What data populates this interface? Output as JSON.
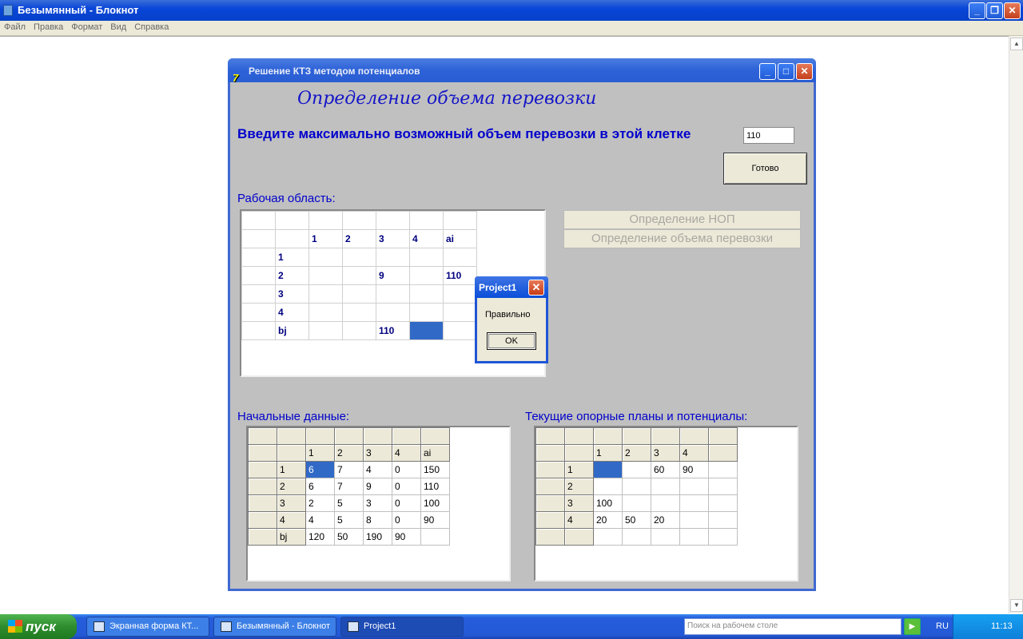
{
  "notepad": {
    "title": "Безымянный - Блокнот",
    "menu": [
      "Файл",
      "Правка",
      "Формат",
      "Вид",
      "Справка"
    ]
  },
  "app": {
    "title": "Решение КТЗ методом потенциалов",
    "header": "Определение объема перевозки",
    "prompt": "Введите максимально возможный объем перевозки в этой клетке",
    "input_value": "110",
    "ready_button": "Готово",
    "workarea_label": "Рабочая область:",
    "btn_nop": "Определение НОП",
    "btn_volume": "Определение объема перевозки",
    "initial_label": "Начальные данные:",
    "current_label": "Текущие опорные планы и потенциалы:",
    "work_grid": [
      [
        "",
        "",
        "",
        "",
        "",
        "",
        ""
      ],
      [
        "",
        "",
        "1",
        "2",
        "3",
        "4",
        "ai"
      ],
      [
        "",
        "1",
        "",
        "",
        "",
        "",
        ""
      ],
      [
        "",
        "2",
        "",
        "",
        "9",
        "",
        "110"
      ],
      [
        "",
        "3",
        "",
        "",
        "",
        "",
        ""
      ],
      [
        "",
        "4",
        "",
        "",
        "",
        "",
        ""
      ],
      [
        "",
        "bj",
        "",
        "",
        "110",
        "",
        ""
      ]
    ],
    "initial_grid": [
      [
        "",
        "",
        "",
        "",
        "",
        "",
        ""
      ],
      [
        "",
        "",
        "1",
        "2",
        "3",
        "4",
        "ai"
      ],
      [
        "",
        "1",
        "6",
        "7",
        "4",
        "0",
        "150"
      ],
      [
        "",
        "2",
        "6",
        "7",
        "9",
        "0",
        "110"
      ],
      [
        "",
        "3",
        "2",
        "5",
        "3",
        "0",
        "100"
      ],
      [
        "",
        "4",
        "4",
        "5",
        "8",
        "0",
        "90"
      ],
      [
        "",
        "bj",
        "120",
        "50",
        "190",
        "90",
        ""
      ]
    ],
    "current_grid": [
      [
        "",
        "",
        "",
        "",
        "",
        "",
        ""
      ],
      [
        "",
        "",
        "1",
        "2",
        "3",
        "4",
        ""
      ],
      [
        "",
        "1",
        "",
        "",
        "60",
        "90",
        ""
      ],
      [
        "",
        "2",
        "",
        "",
        "",
        "",
        ""
      ],
      [
        "",
        "3",
        "100",
        "",
        "",
        "",
        ""
      ],
      [
        "",
        "4",
        "20",
        "50",
        "20",
        "",
        ""
      ],
      [
        "",
        "",
        "",
        "",
        "",
        "",
        ""
      ]
    ]
  },
  "dialog": {
    "title": "Project1",
    "message": "Правильно",
    "ok": "OK"
  },
  "taskbar": {
    "start": "пуск",
    "tasks": [
      "Экранная форма КТ...",
      "Безымянный - Блокнот",
      "Project1"
    ],
    "search_placeholder": "Поиск на рабочем столе",
    "lang": "RU",
    "clock": "11:13"
  }
}
